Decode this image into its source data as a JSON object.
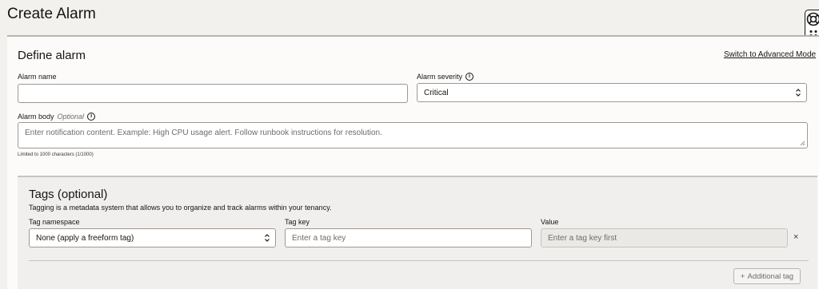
{
  "page": {
    "title": "Create Alarm"
  },
  "define": {
    "title": "Define alarm",
    "advanced_link": "Switch to Advanced Mode",
    "alarm_name": {
      "label": "Alarm name",
      "value": ""
    },
    "alarm_severity": {
      "label": "Alarm severity",
      "value": "Critical"
    },
    "alarm_body": {
      "label": "Alarm body",
      "optional": "Optional",
      "placeholder": "Enter notification content. Example: High CPU usage alert. Follow runbook instructions for resolution.",
      "hint": "Limited to 1000 characters (1/1000)"
    }
  },
  "tags": {
    "title": "Tags (optional)",
    "description": "Tagging is a metadata system that allows you to organize and track alarms within your tenancy.",
    "namespace": {
      "label": "Tag namespace",
      "value": "None (apply a freeform tag)"
    },
    "key": {
      "label": "Tag key",
      "placeholder": "Enter a tag key"
    },
    "value": {
      "label": "Value",
      "placeholder": "Enter a tag key first"
    },
    "remove": "×",
    "add_plus": "+",
    "add_button": "Additional tag"
  }
}
